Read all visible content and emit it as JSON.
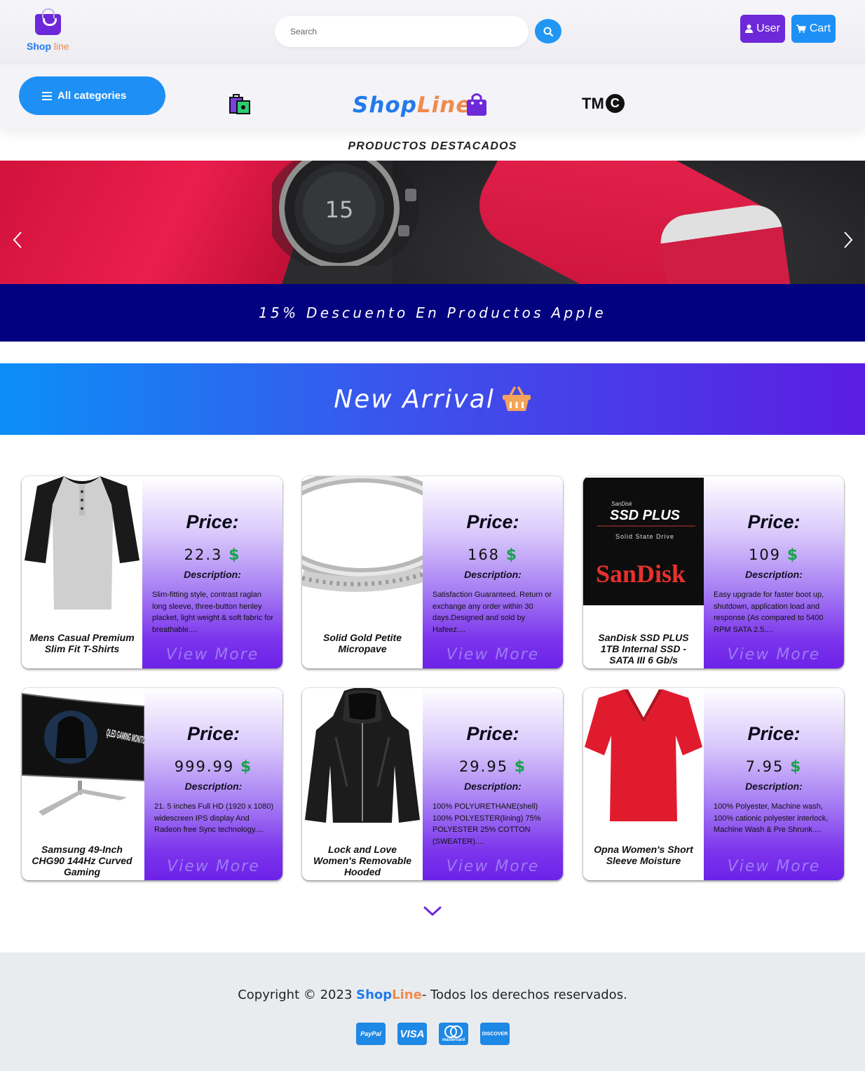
{
  "header": {
    "logo_primary": "Shop",
    "logo_secondary": "line",
    "search_placeholder": "Search",
    "search_value": "",
    "user_label": "User",
    "cart_label": "Cart"
  },
  "categories": {
    "button_label": "All categories",
    "brand_shop": "Shop",
    "brand_line": "Line",
    "brand_tm": "TM",
    "brand_c": "C"
  },
  "featured": {
    "title": "PRODUCTOS DESTACADOS",
    "watch_number": "15",
    "slide_caption": "15% Descuento En Productos Apple"
  },
  "arrival": {
    "title": "New Arrival"
  },
  "product_labels": {
    "price": "Price:",
    "currency": "$",
    "description": "Description:",
    "view_more": "View More"
  },
  "products": [
    {
      "name": "Mens Casual Premium Slim Fit T-Shirts",
      "price": "22.3",
      "description": "Slim-fitting style, contrast raglan long sleeve, three-button henley placket, light weight & soft fabric for breathable...."
    },
    {
      "name": "Solid Gold Petite Micropave",
      "price": "168",
      "description": "Satisfaction Guaranteed. Return or exchange any order within 30 days.Designed and sold by Hafeez...."
    },
    {
      "name": "SanDisk SSD PLUS 1TB Internal SSD - SATA III 6 Gb/s",
      "price": "109",
      "description": "Easy upgrade for faster boot up, shutdown, application load and response (As compared to 5400 RPM SATA 2.5....",
      "image_text": {
        "brand_small": "SanDisk",
        "line": "SSD PLUS",
        "sub": "Solid State Drive",
        "logo": "SanDisk"
      }
    },
    {
      "name": "Samsung 49-Inch CHG90 144Hz Curved Gaming",
      "price": "999.99",
      "description": "21. 5 inches Full HD (1920 x 1080) widescreen IPS display And Radeon free Sync technology....",
      "image_text": {
        "screen": "QLED GAMING MONITOR"
      }
    },
    {
      "name": "Lock and Love Women's Removable Hooded",
      "price": "29.95",
      "description": "100% POLYURETHANE(shell) 100% POLYESTER(lining) 75% POLYESTER 25% COTTON (SWEATER)...."
    },
    {
      "name": "Opna Women's Short Sleeve Moisture",
      "price": "7.95",
      "description": "100% Polyester, Machine wash, 100% cationic polyester interlock, Machine Wash & Pre Shrunk...."
    }
  ],
  "footer": {
    "copyright_prefix": "Copyright © 2023 ",
    "brand_shop": "Shop",
    "brand_line": "Line",
    "copyright_suffix": "- Todos los derechos reservados.",
    "payments": [
      "PayPal",
      "VISA",
      "mastercard",
      "DISCOVER"
    ]
  },
  "colors": {
    "primary_blue": "#1e90f5",
    "primary_purple": "#6d28d9",
    "banner_navy": "#020280",
    "price_green": "#16a34a"
  }
}
